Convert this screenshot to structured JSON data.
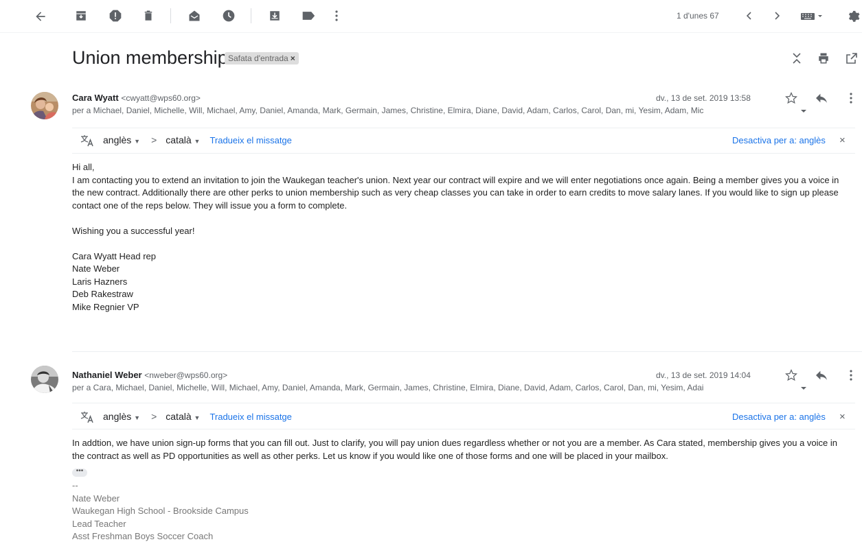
{
  "toolbar": {
    "pager": "1 d'unes 67"
  },
  "thread": {
    "subject": "Union membership",
    "label": "Safata d'entrada",
    "label_close": "×"
  },
  "messages": [
    {
      "sender": "Cara Wyatt",
      "email": "<cwyatt@wps60.org>",
      "recipients": "per a Michael, Daniel, Michelle, Will, Michael, Amy, Daniel, Amanda, Mark, Germain, James, Christine, Elmira, Diane, David, Adam, Carlos, Carol, Dan, mi, Yesim, Adam, Mic",
      "date": "dv., 13 de set. 2019 13:58",
      "translate": {
        "source": "anglès",
        "arrow": ">",
        "target": "català",
        "action": "Tradueix el missatge",
        "disable": "Desactiva per a: anglès",
        "close": "×"
      },
      "body": [
        "Hi all,",
        "I am contacting you to extend an invitation to join the Waukegan teacher's union. Next year our contract will expire and we will enter negotiations once again. Being a member gives you a voice in the new contract. Additionally there are other perks to union membership such as very cheap classes you can take in order to earn credits to move salary lanes. If you would like to sign up please contact one of the reps below. They will issue you a form to complete.",
        "Wishing you a successful year!",
        "Cara Wyatt Head rep",
        "Nate Weber",
        "Laris Hazners",
        "Deb Rakestraw",
        "Mike Regnier VP"
      ]
    },
    {
      "sender": "Nathaniel Weber",
      "email": "<nweber@wps60.org>",
      "recipients": "per a Cara, Michael, Daniel, Michelle, Will, Michael, Amy, Daniel, Amanda, Mark, Germain, James, Christine, Elmira, Diane, David, Adam, Carlos, Carol, Dan, mi, Yesim, Adai",
      "date": "dv., 13 de set. 2019 14:04",
      "translate": {
        "source": "anglès",
        "arrow": ">",
        "target": "català",
        "action": "Tradueix el missatge",
        "disable": "Desactiva per a: anglès",
        "close": "×"
      },
      "body": [
        "In addtion, we have union sign-up forms that you can fill out.  Just to clarify, you will pay union dues regardless whether or not you are a member.  As Cara stated, membership gives you a voice in the contract as well as PD opportunities as well as other perks.  Let us know if you would like one of those forms and one will be placed in your mailbox."
      ],
      "trimmed": "•••",
      "signature": [
        "--",
        "Nate Weber",
        "Waukegan High School - Brookside Campus",
        "Lead Teacher",
        "Asst Freshman Boys Soccer Coach"
      ]
    }
  ],
  "icons": [
    "back-icon",
    "archive-icon",
    "report-spam-icon",
    "delete-icon",
    "mark-unread-icon",
    "snooze-icon",
    "move-to-icon",
    "label-icon",
    "more-vert-icon",
    "prev-icon",
    "next-icon",
    "keyboard-icon",
    "settings-icon",
    "collapse-icon",
    "print-icon",
    "new-window-icon",
    "star-icon",
    "reply-icon",
    "translate-icon"
  ]
}
